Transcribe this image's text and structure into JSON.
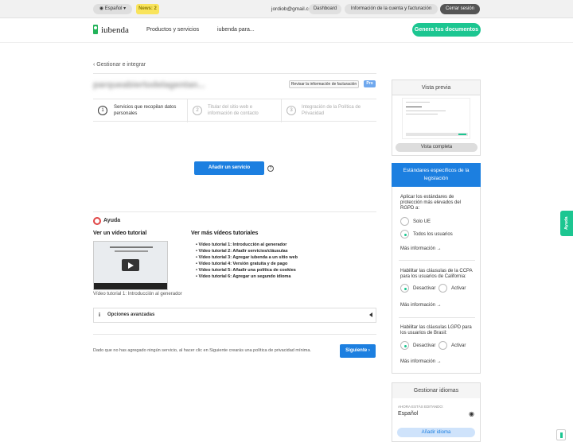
{
  "topbar": {
    "language": "Español",
    "news": "News: 2",
    "email": "jordiob@gmail.com",
    "dashboard": "Dashboard",
    "account": "Información de la cuenta y facturación",
    "logout": "Cerrar sesión"
  },
  "nav": {
    "logo": "iubenda",
    "products": "Productos y servicios",
    "iubenda_for": "iubenda para...",
    "cta": "Genera tus documentos"
  },
  "main": {
    "breadcrumb": "‹ Gestionar e integrar",
    "site_name": "parqueabiertodelagentan...",
    "billing_button": "Revisar la información de facturación",
    "plan_badge": "Pro",
    "steps": [
      {
        "num": "1",
        "label": "Servicios que recopilan datos personales"
      },
      {
        "num": "2",
        "label": "Titular del sitio web e información de contacto"
      },
      {
        "num": "3",
        "label": "Integración de la Política de Privacidad"
      }
    ],
    "add_service": "Añadir un servicio",
    "help_q": "?",
    "help_title": "Ayuda",
    "watch_video": "Ver un vídeo tutorial",
    "more_videos": "Ver más vídeos tutoriales",
    "video_caption": "Vídeo tutorial 1: Introducción al generador",
    "tutorials": [
      "Vídeo tutorial 1: Introducción al generador",
      "Vídeo tutorial 2: Añadir servicios/cláusulas",
      "Vídeo tutorial 3: Agregar iubenda a un sitio web",
      "Vídeo tutorial 4: Versión gratuita y de pago",
      "Vídeo tutorial 5: Añadir una política de cookies",
      "Vídeo tutorial 6: Agregar un segundo idioma"
    ],
    "advanced_icon": "i",
    "advanced_options": "Opciones avanzadas",
    "footer_note": "Dado que no has agregado ningún servicio, al hacer clic en Siguiente crearás una política de privacidad mínima.",
    "next": "Siguiente ›"
  },
  "sidebar": {
    "preview_title": "Vista previa",
    "full_view": "Vista completa",
    "standards_title": "Estándares específicos de la legislación",
    "gdpr_question": "Aplicar los estándares de protección más elevados del RGPD a:",
    "gdpr_options": [
      "Solo UE",
      "Todos los usuarios"
    ],
    "more_info": "Más información →",
    "ccpa_question": "Habilitar las cláusulas de la CCPA para los usuarios de California:",
    "ccpa_options": [
      "Desactivar",
      "Activar"
    ],
    "lgpd_question": "Habilitar las cláusulas LGPD para los usuarios de Brasil:",
    "lgpd_options": [
      "Desactivar",
      "Activar"
    ],
    "languages_title": "Gestionar idiomas",
    "editing_label": "AHORA ESTÁS EDITANDO:",
    "editing_lang": "Español",
    "add_language": "Añadir idioma"
  },
  "side_tab": "Ayuda"
}
